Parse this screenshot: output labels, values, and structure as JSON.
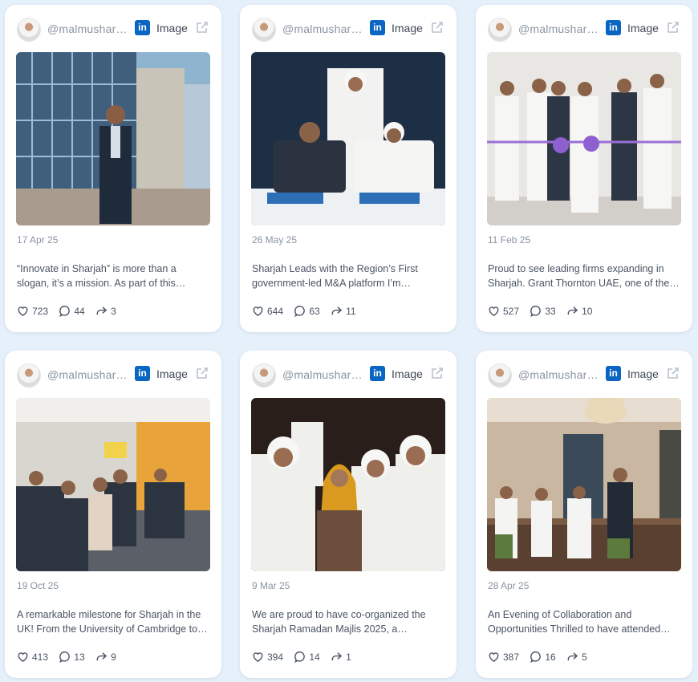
{
  "colors": {
    "background": "#e6f0fa",
    "card": "#ffffff",
    "linkedin": "#0a66c2",
    "muted": "#8a94a3"
  },
  "icons": {
    "network": "linkedin-icon",
    "external": "external-link-icon",
    "likes": "heart-icon",
    "comments": "comment-icon",
    "shares": "share-icon"
  },
  "posts": [
    {
      "handle": "@malmusharraf",
      "network_badge": "in",
      "media_type": "Image",
      "date": "17 Apr 25",
      "text": "“Innovate in Sharjah” is more than a slogan, it’s a mission. As part of this…",
      "likes": "723",
      "comments": "44",
      "shares": "3"
    },
    {
      "handle": "@malmusharraf",
      "network_badge": "in",
      "media_type": "Image",
      "date": "26 May 25",
      "text": "Sharjah Leads with the Region’s First government-led M&A platform I’m…",
      "likes": "644",
      "comments": "63",
      "shares": "11"
    },
    {
      "handle": "@malmusharraf",
      "network_badge": "in",
      "media_type": "Image",
      "date": "11 Feb 25",
      "text": "Proud to see leading firms expanding in Sharjah. Grant Thornton UAE, one of the…",
      "likes": "527",
      "comments": "33",
      "shares": "10"
    },
    {
      "handle": "@malmusharraf",
      "network_badge": "in",
      "media_type": "Image",
      "date": "19 Oct 25",
      "text": "A remarkable milestone for Sharjah in the UK! From the University of Cambridge to…",
      "likes": "413",
      "comments": "13",
      "shares": "9"
    },
    {
      "handle": "@malmusharraf",
      "network_badge": "in",
      "media_type": "Image",
      "date": "9 Mar 25",
      "text": "We are proud to have co-organized the Sharjah Ramadan Majlis 2025, a…",
      "likes": "394",
      "comments": "14",
      "shares": "1"
    },
    {
      "handle": "@malmusharraf",
      "network_badge": "in",
      "media_type": "Image",
      "date": "28 Apr 25",
      "text": "An Evening of Collaboration and Opportunities Thrilled to have attended…",
      "likes": "387",
      "comments": "16",
      "shares": "5"
    }
  ]
}
